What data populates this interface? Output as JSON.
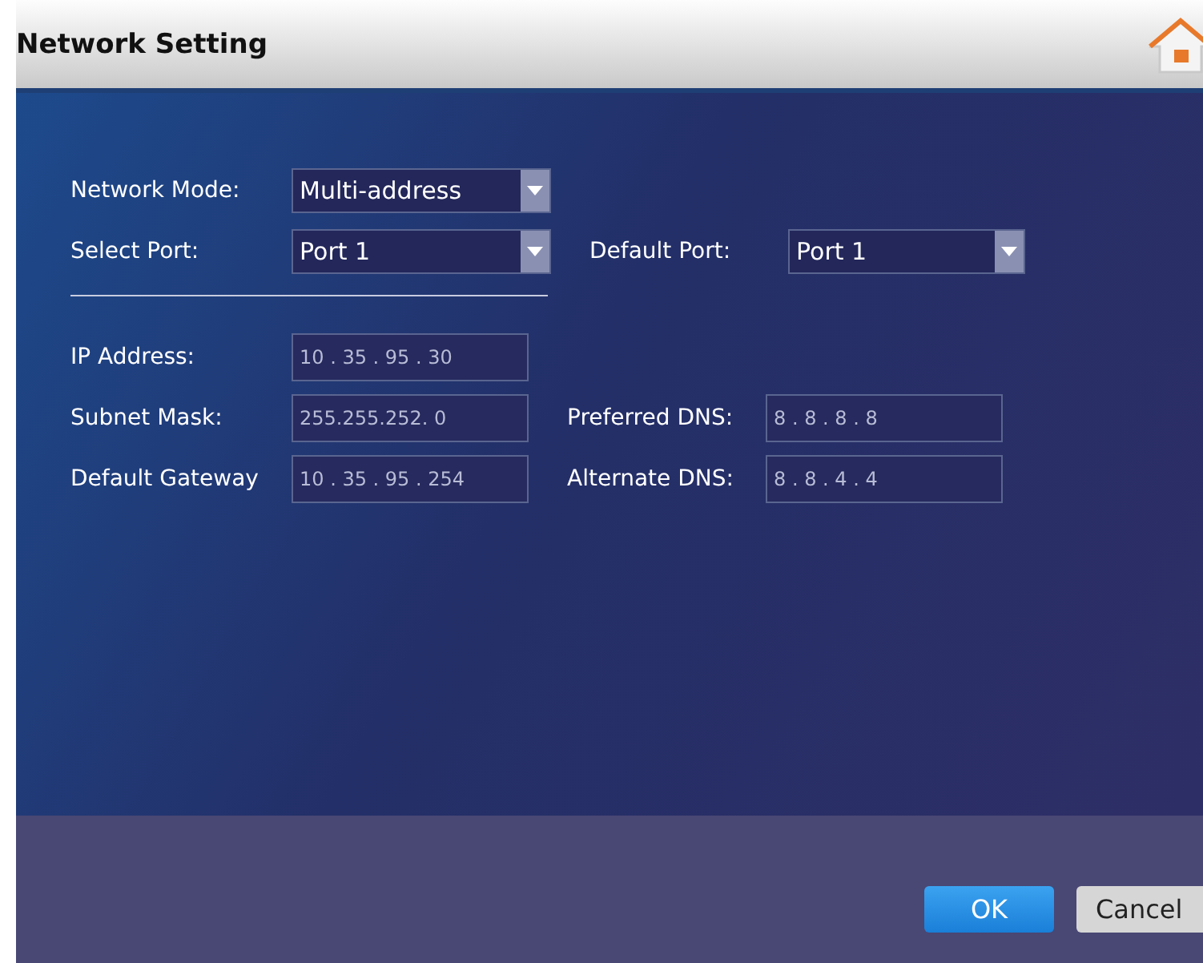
{
  "window": {
    "title": "Network Setting"
  },
  "settings": [
    {
      "label": "Network Mode:",
      "value": "Multi-address"
    },
    {
      "label": "Select Port:",
      "value": "Port 1"
    },
    {
      "label": "Default Port:",
      "value": "Port 1"
    }
  ],
  "addresses": [
    {
      "label": "IP Address:",
      "value": "10 . 35 . 95 . 30"
    },
    {
      "label": "Subnet Mask:",
      "value": "255.255.252. 0"
    },
    {
      "label": "Preferred DNS:",
      "value": "8 . 8 . 8 . 8"
    },
    {
      "label": "Default Gateway",
      "value": "10 . 35 . 95 . 254"
    },
    {
      "label": "Alternate DNS:",
      "value": "8 . 8 . 4 . 4"
    }
  ],
  "buttons": [
    {
      "label": "OK",
      "kind": "primary"
    },
    {
      "label": "Cancel",
      "kind": "secondary"
    }
  ]
}
